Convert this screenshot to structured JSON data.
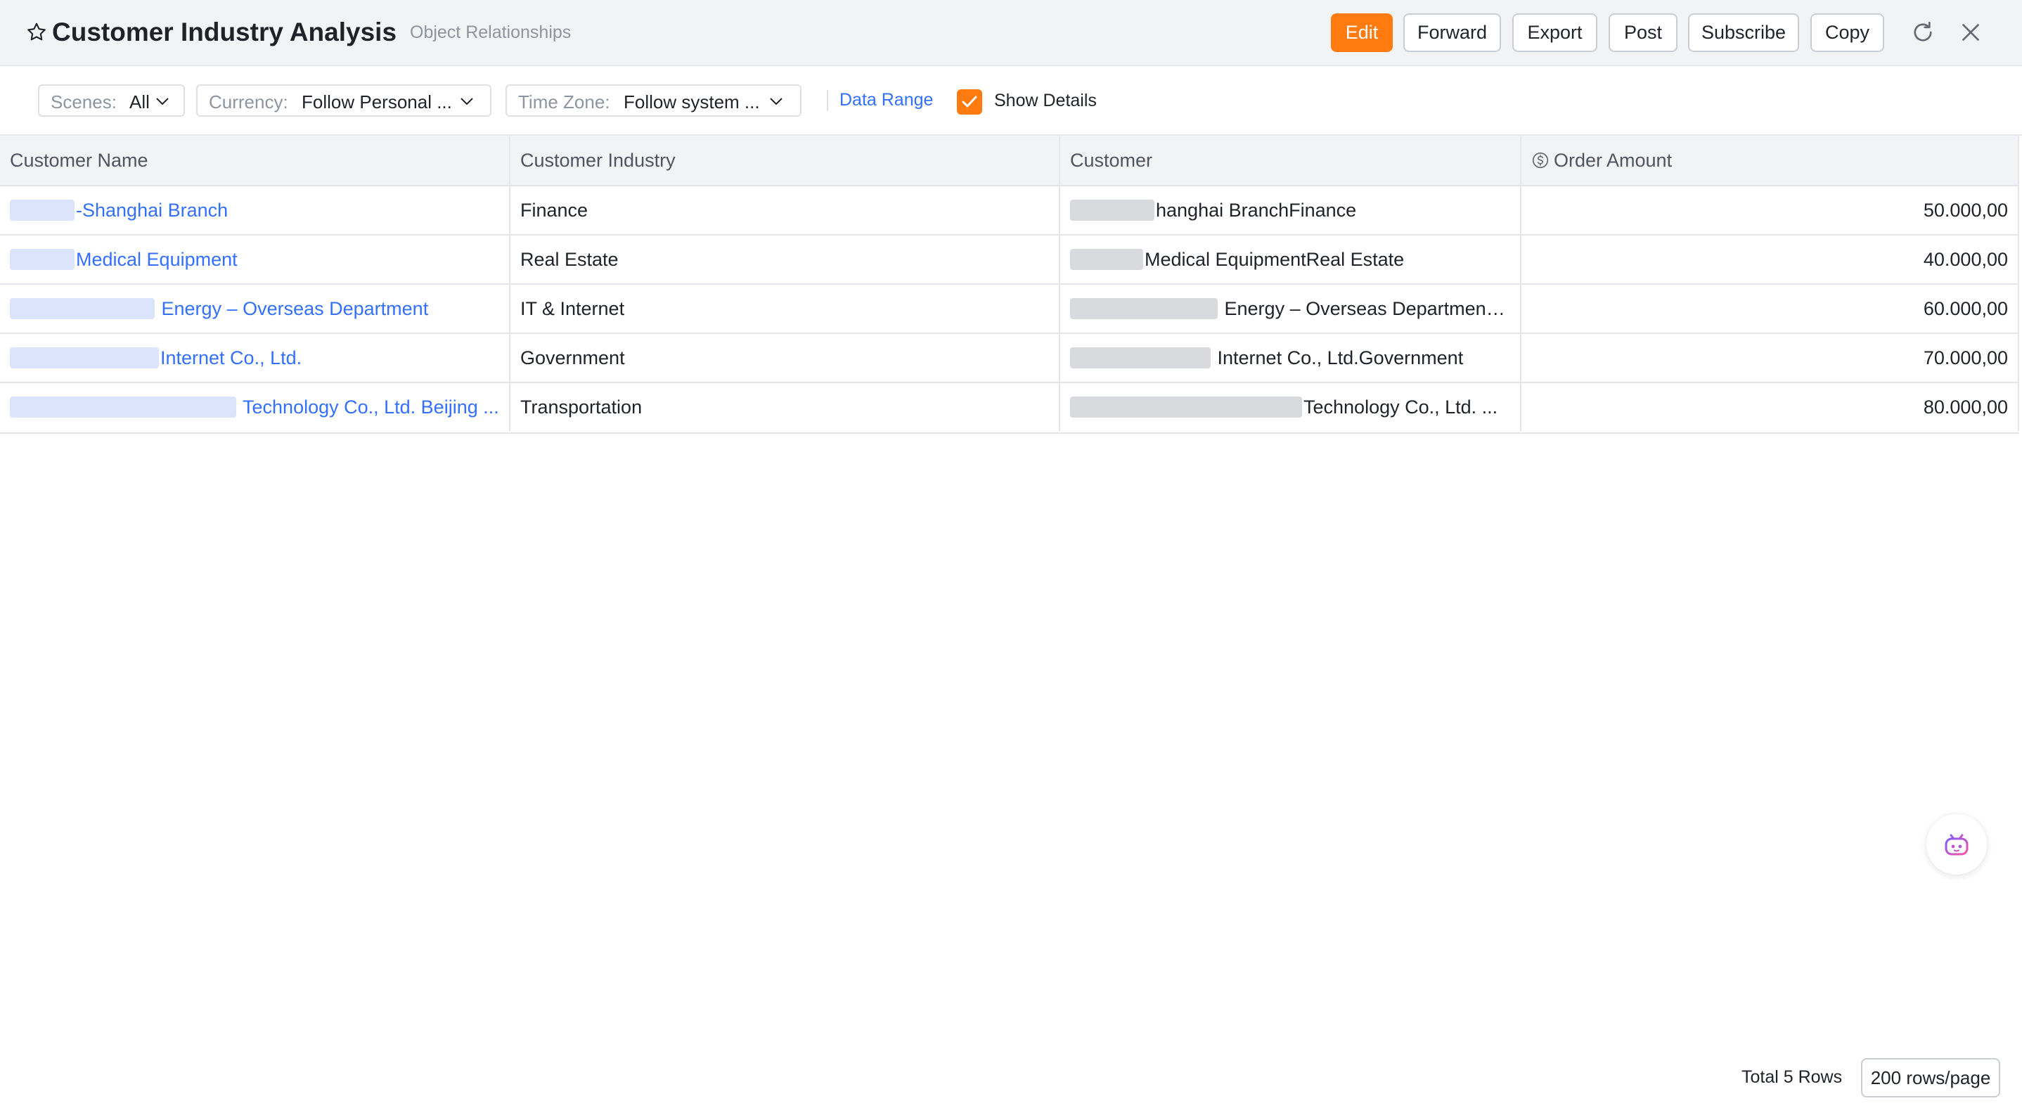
{
  "header": {
    "title": "Customer Industry Analysis",
    "subtitle": "Object Relationships",
    "buttons": {
      "edit": "Edit",
      "forward": "Forward",
      "export": "Export",
      "post": "Post",
      "subscribe": "Subscribe",
      "copy": "Copy"
    },
    "icons": [
      "star-icon",
      "refresh-icon",
      "close-icon"
    ]
  },
  "filters": {
    "scenes": {
      "label": "Scenes:",
      "value": "All"
    },
    "currency": {
      "label": "Currency:",
      "value": "Follow Personal ..."
    },
    "timezone": {
      "label": "Time Zone:",
      "value": "Follow system ..."
    },
    "data_range": "Data Range",
    "show_details": {
      "label": "Show Details",
      "checked": true
    }
  },
  "table": {
    "columns": [
      "Customer Name",
      "Customer Industry",
      "Customer",
      "Order Amount"
    ],
    "rows": [
      {
        "name": "-Shanghai Branch",
        "industry": "Finance",
        "customer": "hanghai BranchFinance",
        "amount": "50.000,00"
      },
      {
        "name": "Medical Equipment",
        "industry": "Real Estate",
        "customer": "Medical EquipmentReal Estate",
        "amount": "40.000,00"
      },
      {
        "name": "Energy – Overseas Department",
        "industry": "IT & Internet",
        "customer": "Energy – Overseas Department…",
        "amount": "60.000,00"
      },
      {
        "name": "Internet Co., Ltd.",
        "industry": "Government",
        "customer": "Internet Co., Ltd.Government",
        "amount": "70.000,00"
      },
      {
        "name": "Technology Co., Ltd. Beijing ...",
        "industry": "Transportation",
        "customer": "Technology Co., Ltd. ...",
        "amount": "80.000,00"
      }
    ]
  },
  "footer": {
    "total": "Total 5 Rows",
    "page_size": "200 rows/page"
  },
  "colors": {
    "accent": "#ff7a0f",
    "link": "#3370ff",
    "header_bg": "#f2f3f5"
  }
}
